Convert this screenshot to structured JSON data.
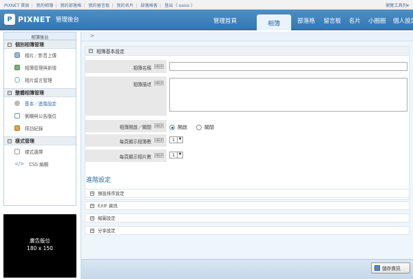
{
  "topbar": {
    "links": [
      "PIXNET 首頁",
      "我的相簿",
      "我的部落格",
      "我的留言板",
      "我的名片",
      "部落格客",
      "登出（ oasis ）"
    ],
    "tools": "瀏覽工具列"
  },
  "header": {
    "logo_text": "PIXNET",
    "logo_sub": "管理後台",
    "nav": [
      "管理首頁",
      "相簿",
      "部落格",
      "留言板",
      "名片",
      "小圈圈",
      "個人設定"
    ],
    "active_nav": "相簿"
  },
  "sidebar": {
    "title": "相簿後台",
    "sections": [
      {
        "label": "個別相簿管理",
        "items": [
          "相片／影音上傳",
          "相簿管理與新增",
          "相片留言管理"
        ]
      },
      {
        "label": "整體相簿管理",
        "items": [
          "基本／進階設定",
          "側欄與公告版位",
          "拜訪紀錄"
        ]
      },
      {
        "label": "樣式管理",
        "items": [
          "樣式選擇",
          "CSS 編輯"
        ]
      }
    ],
    "current_item": "基本／進階設定"
  },
  "ad": {
    "line1": "廣告版位",
    "line2": "180 x 150"
  },
  "main": {
    "breadcrumb": ">",
    "basic_title": "相簿基本設定",
    "help_label": "HELP",
    "name_label": "相簿名稱",
    "name_value": "",
    "desc_label": "相簿描述",
    "desc_value": "",
    "open_label": "相簿開啟／關閉",
    "radio_open": "開啟",
    "radio_close": "關閉",
    "open_selected": "開啟",
    "albums_per_page_label": "每頁顯示相簿數",
    "albums_per_page": "1",
    "photos_per_page_label": "每頁顯示相片數",
    "photos_per_page": "1",
    "advanced_title": "進階設定",
    "advanced_items": [
      "預設排序設定",
      "EXIF 資訊",
      "縮圖設定",
      "分享設定"
    ],
    "save_label": "儲存資訊"
  },
  "colors": {
    "accent": "#3a7cb8",
    "bar": "#c6d8ea"
  }
}
